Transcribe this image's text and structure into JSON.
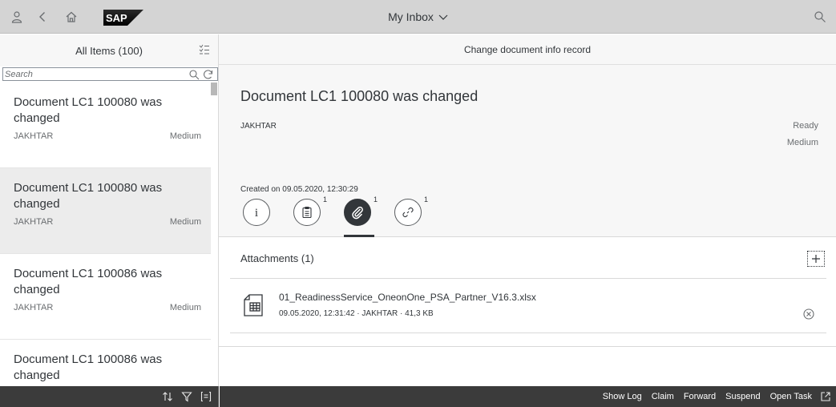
{
  "shell": {
    "title": "My Inbox",
    "icons": [
      "user-icon",
      "back-icon",
      "home-icon",
      "search-icon"
    ],
    "logo_text": "SAP"
  },
  "master": {
    "header": "All Items (100)",
    "search_placeholder": "Search",
    "items": [
      {
        "title": "Document LC1 100080 was changed",
        "creator": "JAKHTAR",
        "priority": "Medium"
      },
      {
        "title": "Document LC1 100080 was changed",
        "creator": "JAKHTAR",
        "priority": "Medium"
      },
      {
        "title": "Document LC1 100086 was changed",
        "creator": "JAKHTAR",
        "priority": "Medium"
      },
      {
        "title": "Document LC1 100086 was changed"
      }
    ]
  },
  "detail": {
    "header": "Change document info record",
    "title": "Document LC1 100080 was changed",
    "creator": "JAKHTAR",
    "status": "Ready",
    "priority": "Medium",
    "created": "Created on 09.05.2020, 12:30:29",
    "tabs": [
      {
        "name": "info",
        "count": ""
      },
      {
        "name": "notes",
        "count": "1"
      },
      {
        "name": "attachments",
        "count": "1"
      },
      {
        "name": "links",
        "count": "1"
      }
    ],
    "attachments": {
      "header": "Attachments (1)",
      "items": [
        {
          "file": "01_ReadinessService_OneonOne_PSA_Partner_V16.3.xlsx",
          "info": "09.05.2020, 12:31:42 · JAKHTAR · 41,3 KB"
        }
      ]
    }
  },
  "footer": {
    "actions": [
      "Show Log",
      "Claim",
      "Forward",
      "Suspend",
      "Open Task"
    ]
  },
  "colors": {
    "shell_bg": "#d4d4d4",
    "footer_bg": "#3b3b3b",
    "selected_item_bg": "#ececec",
    "header_bg": "#f7f7f7"
  }
}
